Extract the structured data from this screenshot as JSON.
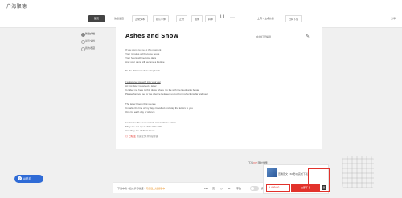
{
  "app": {
    "logo": "户海聚德"
  },
  "toolbar": {
    "nav_button": "首页",
    "items": [
      "快捷设置",
      "正常文本",
      "默认字体",
      "正常",
      "粗体",
      "斜体"
    ],
    "ai_label": "上传 / 生成文档",
    "qr_label": "扫码下载",
    "right_label": "分享"
  },
  "sidebar": {
    "items": [
      "新建文档",
      "最近文档",
      "我的收藏"
    ]
  },
  "document": {
    "title": "Ashes and Snow",
    "hint": "在线打开编辑",
    "paragraphs": [
      [
        "If you come to me at this moment",
        "Your minutes will become hours",
        "Your hours will become days",
        "And your days will become a lifetime"
      ],
      [
        "To the Princess of the Elephants"
      ],
      [
        "I whispered sweetly into your ear",
        "At first day, I received a letter",
        "It called me here to this place where my life with the Elephants began",
        "Please forgive me for the silence between us but from reflections far and near"
      ],
      [
        "The letter bloom that silence",
        "It marks the line of my days travelled and stay the letters to you",
        "One for each day of silence"
      ],
      [
        "I will leave the room myself now to these letters",
        "They are our ages of the full earth",
        "And they are all that I know"
      ]
    ],
    "meta_tag": "◎ 已标注",
    "meta_text": "阅读全文     共5段内容"
  },
  "bottom_bar": {
    "notice_prefix": "下载本篇 / 加入学习收藏 · ",
    "notice_highlight": "可任选文档或版本",
    "page_count": "122",
    "page_label": "页",
    "word_count": "96",
    "word_label": "字数",
    "font_label": "阅读模式"
  },
  "promo": {
    "header_prefix": "下载",
    "header_highlight": "VIP",
    "header_suffix": " 限时优惠",
    "text": "查看原文 · 60 秒内完成下载",
    "price": "¥ 499.00",
    "buy": "立即下载",
    "copy": "复"
  },
  "help": {
    "label": "AI助手"
  }
}
